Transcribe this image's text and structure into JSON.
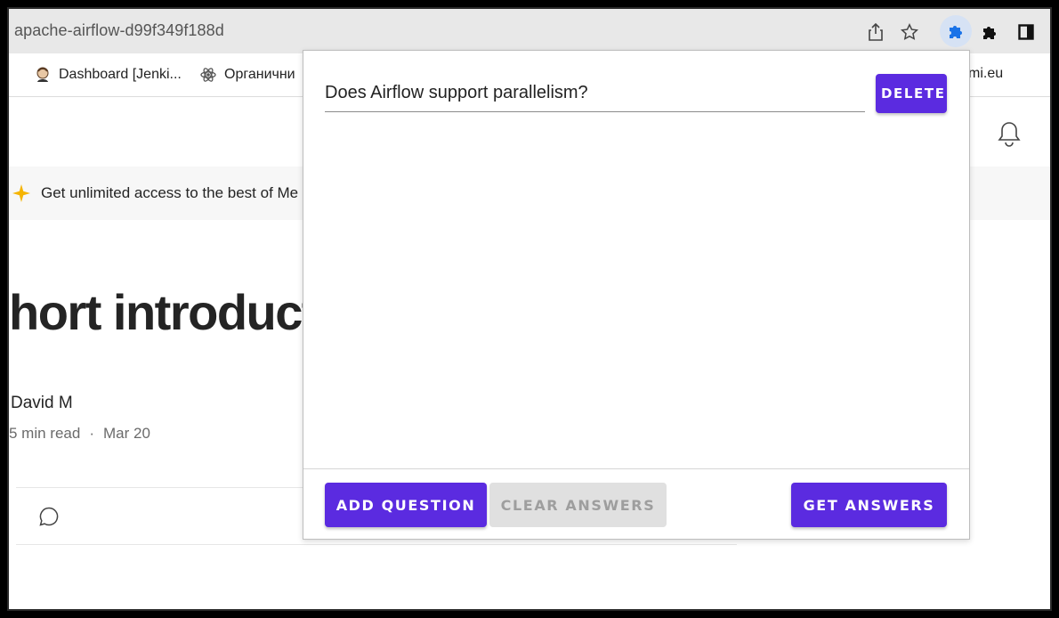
{
  "browser": {
    "url_text": "apache-airflow-d99f349f188d",
    "icons": [
      "share-icon",
      "star-icon",
      "extension-puzzle-icon",
      "extensions-icon",
      "sidebar-icon"
    ],
    "bookmarks": [
      {
        "label": "Dashboard [Jenki...",
        "icon": "jenkins-icon"
      },
      {
        "label": "Органични",
        "icon": "atom-icon"
      },
      {
        "label": "mi.eu",
        "icon": ""
      }
    ]
  },
  "article": {
    "banner_text": "Get unlimited access to the best of Me",
    "headline": "hort introducti",
    "author": "David M",
    "read_time": "5 min read",
    "separator": "·",
    "date": "Mar 20"
  },
  "popup": {
    "question_value": "Does Airflow support parallelism?",
    "delete_label": "DELETE",
    "add_question_label": "ADD QUESTION",
    "clear_answers_label": "CLEAR ANSWERS",
    "get_answers_label": "GET ANSWERS"
  },
  "colors": {
    "accent": "#5b2be0",
    "disabled_bg": "#e0e0e0",
    "extension_highlight": "#d6e2f4",
    "star": "#f5b400"
  }
}
